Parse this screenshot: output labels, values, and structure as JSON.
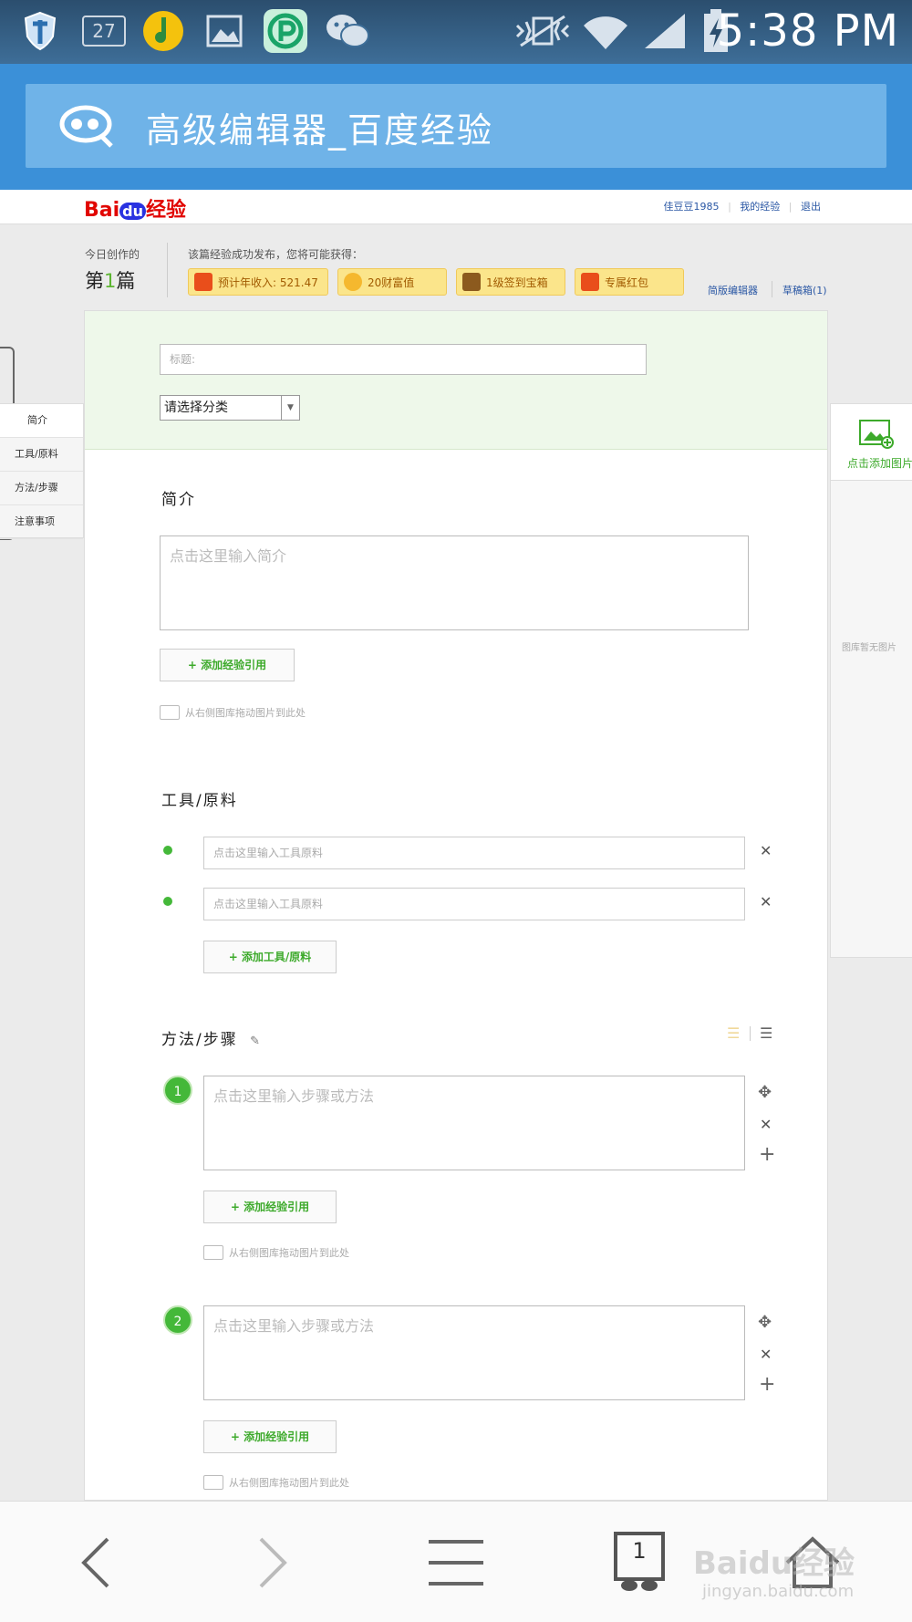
{
  "status_bar": {
    "notification_count": "27",
    "time": "5:38 PM"
  },
  "browser": {
    "page_title": "高级编辑器_百度经验",
    "tab_count": "1"
  },
  "header": {
    "logo_bai": "Bai",
    "logo_du": "du",
    "logo_suffix": "经验",
    "username": "佳豆豆1985",
    "my_experience": "我的经验",
    "logout": "退出"
  },
  "stats": {
    "today_label": "今日创作的",
    "today_prefix": "第",
    "today_num": "1",
    "today_suffix": "篇",
    "reward_title": "该篇经验成功发布，您将可能获得：",
    "rewards": [
      {
        "label": "预计年收入: 521.47"
      },
      {
        "label": "20财富值"
      },
      {
        "label": "1级签到宝箱"
      },
      {
        "label": "专属红包"
      }
    ],
    "simple_editor": "简版编辑器",
    "drafts": "草稿箱(1)"
  },
  "form": {
    "title_placeholder": "标题:",
    "category_placeholder": "请选择分类"
  },
  "intro": {
    "title": "简介",
    "placeholder": "点击这里输入简介",
    "add_ref": "+ 添加经验引用",
    "drag_hint": "从右侧图库拖动图片到此处"
  },
  "tools": {
    "title": "工具/原料",
    "placeholders": [
      "点击这里输入工具原料",
      "点击这里输入工具原料"
    ],
    "add": "+ 添加工具/原料"
  },
  "steps": {
    "title": "方法/步骤",
    "items": [
      {
        "num": "1",
        "placeholder": "点击这里输入步骤或方法",
        "add_ref": "+ 添加经验引用",
        "drag_hint": "从右侧图库拖动图片到此处"
      },
      {
        "num": "2",
        "placeholder": "点击这里输入步骤或方法",
        "add_ref": "+ 添加经验引用",
        "drag_hint": "从右侧图库拖动图片到此处"
      }
    ]
  },
  "left_nav": {
    "items": [
      "简介",
      "工具/原料",
      "方法/步骤",
      "注意事项"
    ]
  },
  "right_panel": {
    "add_image": "点击添加图片",
    "empty": "图库暂无图片"
  },
  "watermark": {
    "main": "Baidu经验",
    "sub": "jingyan.baidu.com"
  },
  "colors": {
    "accent_green": "#44b839",
    "browser_blue": "#3b90d8",
    "link_blue": "#2a57a4"
  }
}
